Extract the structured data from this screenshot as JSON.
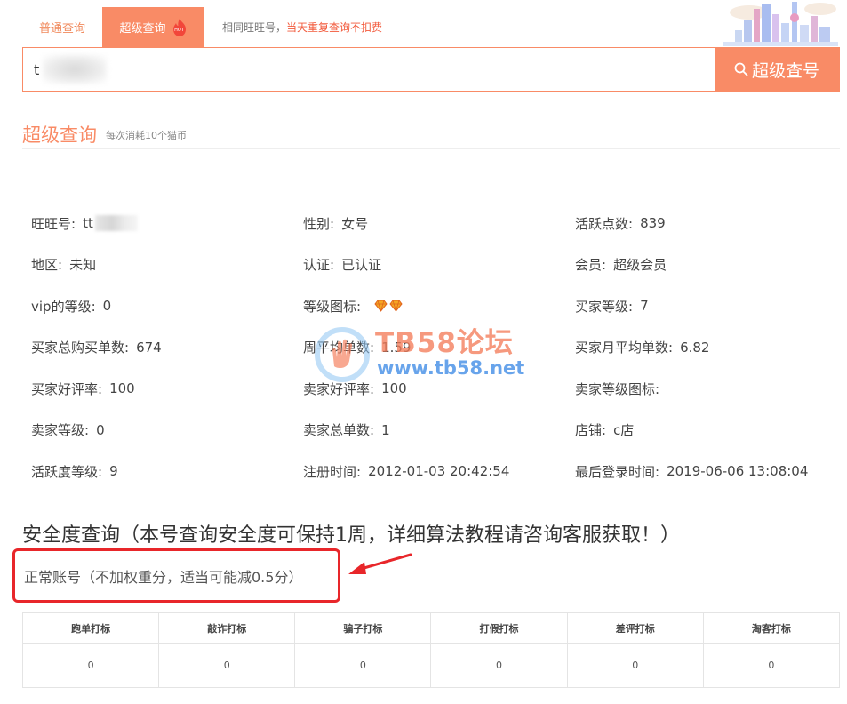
{
  "tabs": [
    {
      "label": "普通查询"
    },
    {
      "label": "超级查询",
      "badge": "HOT"
    }
  ],
  "tab_note": {
    "prefix": "相同旺旺号，",
    "highlight": "当天重复查询不扣费"
  },
  "search": {
    "value": "t",
    "button_label": "超级查号"
  },
  "section": {
    "title": "超级查询",
    "subtitle": "每次消耗10个猫币"
  },
  "info": [
    {
      "label": "旺旺号:",
      "value": "tt",
      "masked": true
    },
    {
      "label": "性别:",
      "value": "女号"
    },
    {
      "label": "活跃点数:",
      "value": "839"
    },
    {
      "label": "地区:",
      "value": "未知"
    },
    {
      "label": "认证:",
      "value": "已认证"
    },
    {
      "label": "会员:",
      "value": "超级会员"
    },
    {
      "label": "vip的等级:",
      "value": "0"
    },
    {
      "label": "等级图标:",
      "value": "",
      "icon": "diamond-icon"
    },
    {
      "label": "买家等级:",
      "value": "7"
    },
    {
      "label": "买家总购买单数:",
      "value": "674"
    },
    {
      "label": "周平均单数:",
      "value": "1.59"
    },
    {
      "label": "买家月平均单数:",
      "value": "6.82"
    },
    {
      "label": "买家好评率:",
      "value": "100"
    },
    {
      "label": "卖家好评率:",
      "value": "100"
    },
    {
      "label": "卖家等级图标:",
      "value": ""
    },
    {
      "label": "卖家等级:",
      "value": "0"
    },
    {
      "label": "卖家总单数:",
      "value": "1"
    },
    {
      "label": "店铺:",
      "value": "c店"
    },
    {
      "label": "活跃度等级:",
      "value": "9"
    },
    {
      "label": "注册时间:",
      "value": "2012-01-03 20:42:54"
    },
    {
      "label": "最后登录时间:",
      "value": "2019-06-06 13:08:04"
    }
  ],
  "watermark": {
    "title": "TB58论坛",
    "url": "www.tb58.net"
  },
  "safety": {
    "title": "安全度查询（本号查询安全度可保持1周，详细算法教程请咨询客服获取！）",
    "status": "正常账号（不加权重分，适当可能减0.5分）"
  },
  "flags": {
    "headers": [
      "跑单打标",
      "敲诈打标",
      "骗子打标",
      "打假打标",
      "差评打标",
      "淘客打标"
    ],
    "values": [
      "0",
      "0",
      "0",
      "0",
      "0",
      "0"
    ]
  },
  "colors": {
    "accent": "#f98b66",
    "highlight_red": "#e8262a",
    "note_red": "#f25a3c",
    "watermark_blue": "#3e8be6"
  }
}
